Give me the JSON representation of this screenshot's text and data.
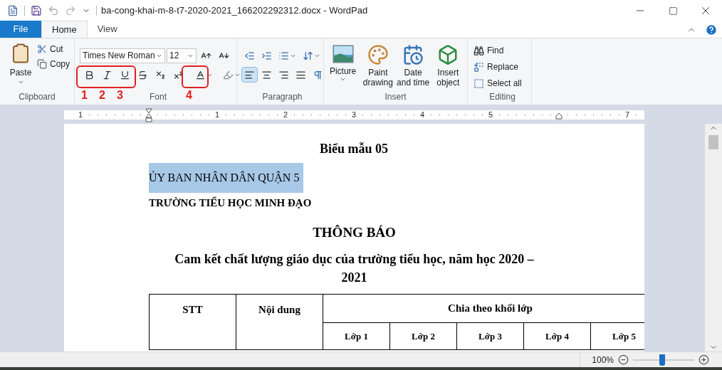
{
  "window": {
    "title": "ba-cong-khai-m-8-t7-2020-2021_166202292312.docx - WordPad"
  },
  "tabs": [
    {
      "label": "File",
      "kind": "file",
      "selected": false
    },
    {
      "label": "Home",
      "kind": "tab",
      "selected": true
    },
    {
      "label": "View",
      "kind": "tab",
      "selected": false
    }
  ],
  "ribbon": {
    "clipboard": {
      "label": "Clipboard",
      "paste": "Paste",
      "cut": "Cut",
      "copy": "Copy"
    },
    "font": {
      "label": "Font",
      "family": "Times New Roman",
      "size": "12"
    },
    "paragraph": {
      "label": "Paragraph",
      "alignments": [
        {
          "kind": "left",
          "selected": true
        },
        {
          "kind": "center",
          "selected": false
        },
        {
          "kind": "right",
          "selected": false
        },
        {
          "kind": "justify",
          "selected": false
        }
      ]
    },
    "insert": {
      "label": "Insert",
      "items": [
        {
          "kind": "picture",
          "label": "Picture"
        },
        {
          "kind": "paint",
          "label": "Paint drawing"
        },
        {
          "kind": "datetime",
          "label": "Date and time"
        },
        {
          "kind": "object",
          "label": "Insert object"
        }
      ]
    },
    "editing": {
      "label": "Editing",
      "items": [
        {
          "kind": "find",
          "label": "Find"
        },
        {
          "kind": "replace",
          "label": "Replace"
        },
        {
          "kind": "selectall",
          "label": "Select all"
        }
      ]
    }
  },
  "annotations": [
    "1",
    "2",
    "3",
    "4"
  ],
  "ruler": {
    "labels": [
      "1",
      "1",
      "2",
      "3",
      "4",
      "5",
      "7"
    ]
  },
  "document": {
    "form": "Biểu mẫu 05",
    "authority": "ỦY BAN NHÂN DÂN QUẬN 5",
    "authority_highlighted": true,
    "school": "TRƯỜNG TIỂU HỌC MINH ĐẠO",
    "heading": "THÔNG BÁO",
    "subtitle": "Cam kết chất lượng giáo dục của trường tiểu học, năm học 2020 – 2021",
    "table": {
      "columns": [
        "STT",
        "Nội dung",
        "Chia theo khối lớp"
      ],
      "subcolumns": [
        "Lớp 1",
        "Lớp 2",
        "Lớp 3",
        "Lớp 4",
        "Lớp 5"
      ]
    }
  },
  "status_bar": {
    "zoom": "100%",
    "level": 0.48
  }
}
